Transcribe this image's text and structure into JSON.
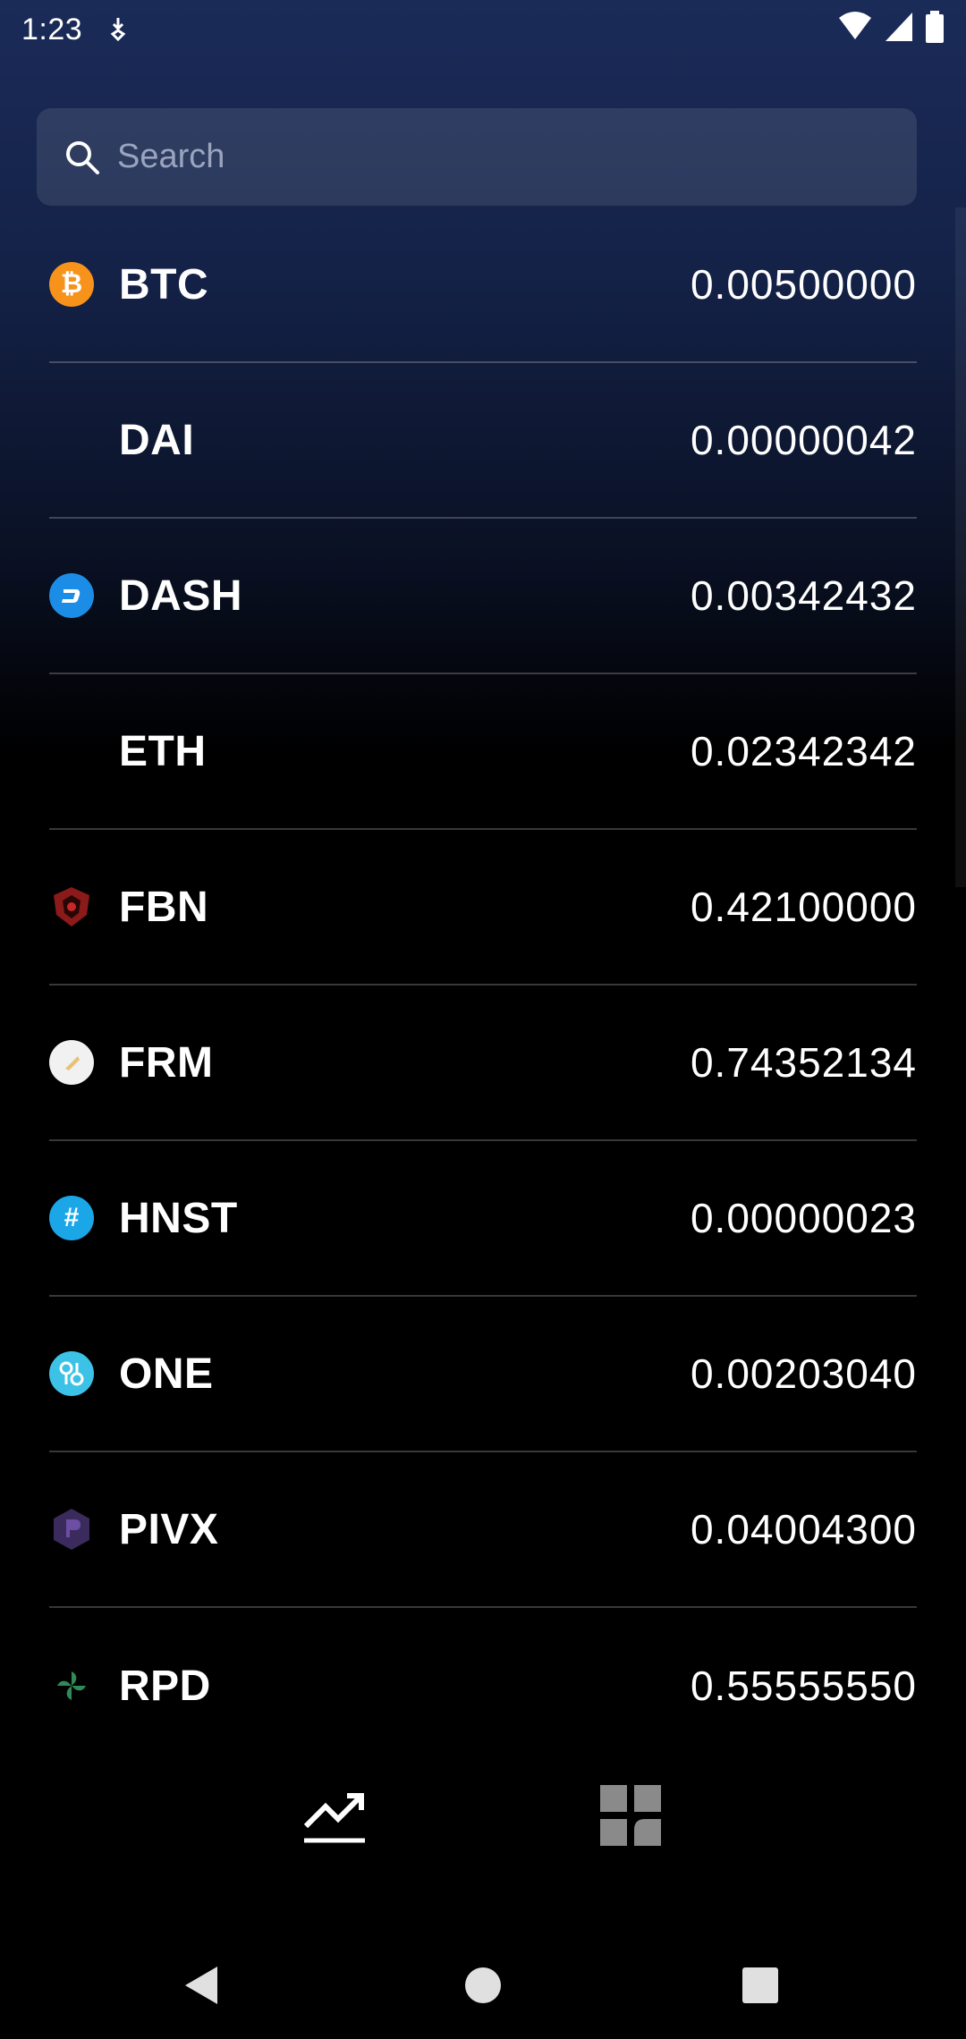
{
  "status_bar": {
    "time": "1:23"
  },
  "search": {
    "placeholder": "Search",
    "value": ""
  },
  "coins": [
    {
      "symbol": "BTC",
      "value": "0.00500000",
      "icon": "bitcoin-icon",
      "color": "#f7931a",
      "glyph": "₿"
    },
    {
      "symbol": "DAI",
      "value": "0.00000042",
      "icon": "",
      "color": "",
      "glyph": ""
    },
    {
      "symbol": "DASH",
      "value": "0.00342432",
      "icon": "dash-icon",
      "color": "#1c8de6",
      "glyph": "D"
    },
    {
      "symbol": "ETH",
      "value": "0.02342342",
      "icon": "",
      "color": "",
      "glyph": ""
    },
    {
      "symbol": "FBN",
      "value": "0.42100000",
      "icon": "fbn-icon",
      "color": "#8b1a1a",
      "glyph": ""
    },
    {
      "symbol": "FRM",
      "value": "0.74352134",
      "icon": "frm-icon",
      "color": "#f1f1f1",
      "glyph": ""
    },
    {
      "symbol": "HNST",
      "value": "0.00000023",
      "icon": "hnst-icon",
      "color": "#1ba6e8",
      "glyph": "#"
    },
    {
      "symbol": "ONE",
      "value": "0.00203040",
      "icon": "harmony-one-icon",
      "color": "#3cc2e6",
      "glyph": "⌘"
    },
    {
      "symbol": "PIVX",
      "value": "0.04004300",
      "icon": "pivx-icon",
      "color": "#3b2a5c",
      "glyph": "P"
    },
    {
      "symbol": "RPD",
      "value": "0.55555550",
      "icon": "rpd-icon",
      "color": "#2e8b57",
      "glyph": "✺"
    }
  ],
  "bottom_nav": {
    "items": [
      {
        "icon": "trending-up-icon",
        "active": true
      },
      {
        "icon": "dashboard-icon",
        "active": false
      }
    ]
  },
  "system_nav": {
    "items": [
      "back-icon",
      "home-icon",
      "recents-icon"
    ]
  }
}
